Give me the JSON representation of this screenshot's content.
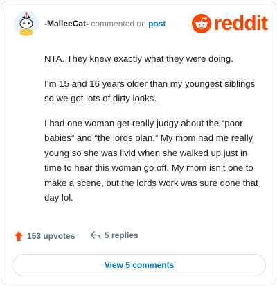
{
  "comment": {
    "username": "-MalleeCat-",
    "action_text": "commented on",
    "post_link": "post",
    "paragraphs": [
      "NTA. They knew exactly what they were doing.",
      "I’m 15 and 16 years older than my youngest siblings so we got lots of dirty looks.",
      "I had one woman get really judgy about the “poor babies” and “the lords plan.” My mom had me really young so she was livid when she walked up just in time to hear this woman go off. My mom isn’t one to make a scene, but the lords work was sure done that day lol."
    ]
  },
  "brand": {
    "name": "reddit",
    "color": "#ff4500",
    "icon": "reddit-snoo-icon"
  },
  "footer": {
    "upvotes_label": "153 upvotes",
    "replies_label": "5 replies",
    "upvote_icon": "upvote-arrow-icon",
    "reply_icon": "reply-arrow-icon",
    "upvote_color": "#ff4500"
  },
  "view_comments_label": "View 5 comments"
}
